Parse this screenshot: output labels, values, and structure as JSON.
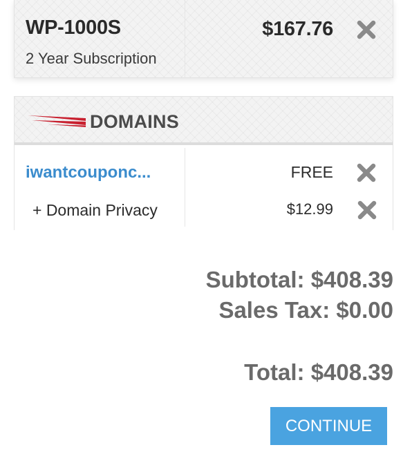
{
  "product": {
    "name": "WP-1000S",
    "term": "2 Year Subscription",
    "price": "$167.76",
    "remove_icon": "close-icon"
  },
  "domains": {
    "title": "DOMAINS",
    "logo_icon": "domains-swoosh-icon",
    "items": [
      {
        "name": "iwantcouponc...",
        "price": "FREE",
        "remove_icon": "close-icon"
      },
      {
        "name": "+ Domain Privacy",
        "price": "$12.99",
        "remove_icon": "close-icon"
      }
    ]
  },
  "totals": {
    "subtotal": "Subtotal: $408.39",
    "tax": "Sales Tax: $0.00",
    "total": "Total: $408.39"
  },
  "actions": {
    "continue_label": "CONTINUE"
  },
  "colors": {
    "accent_button": "#4aa3e0",
    "link": "#3b8ccd",
    "remove_icon": "#8a8a8a",
    "logo_red": "#c8202f"
  }
}
